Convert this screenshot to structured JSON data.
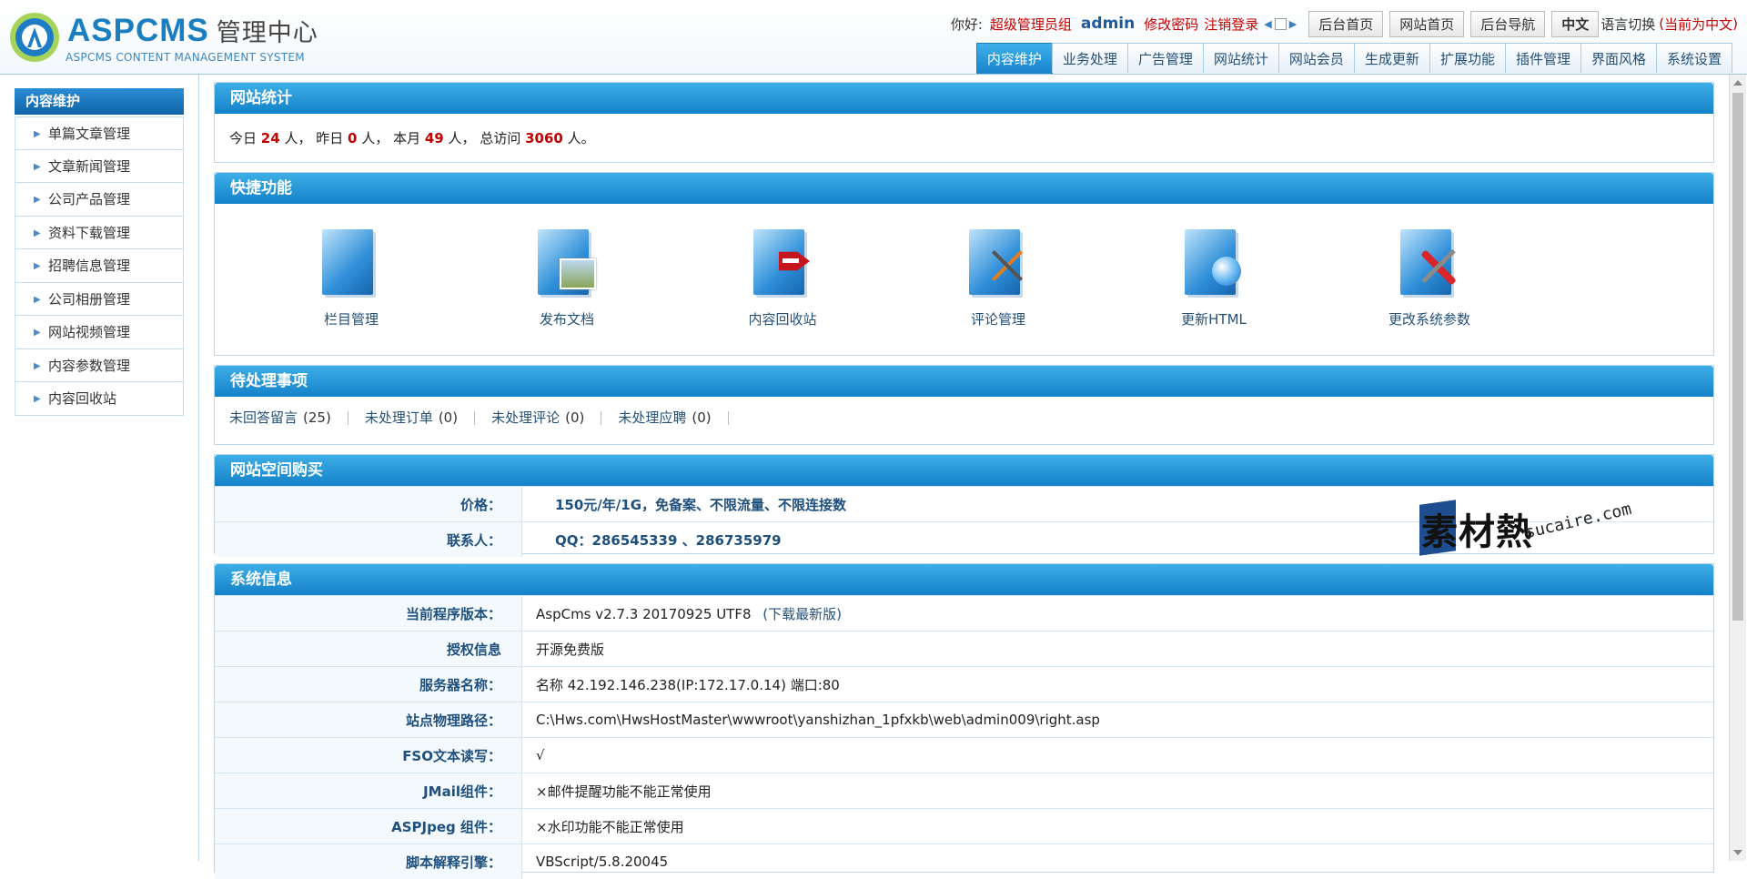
{
  "header": {
    "logo_text": "ASPCMS",
    "logo_subtitle_cn": "管理中心",
    "logo_tagline": "ASPCMS CONTENT MANAGEMENT SYSTEM",
    "greeting": "你好:",
    "role": "超级管理员组",
    "username": "admin",
    "change_password": "修改密码",
    "logout": "注销登录",
    "buttons": [
      "后台首页",
      "网站首页",
      "后台导航",
      "中文"
    ],
    "lang_switch": "语言切换",
    "lang_current_open": "(",
    "lang_current": "当前为中文",
    "lang_current_close": ")",
    "tabs": [
      "内容维护",
      "业务处理",
      "广告管理",
      "网站统计",
      "网站会员",
      "生成更新",
      "扩展功能",
      "插件管理",
      "界面风格",
      "系统设置"
    ],
    "active_tab": "内容维护"
  },
  "sidebar": {
    "title": "内容维护",
    "items": [
      "单篇文章管理",
      "文章新闻管理",
      "公司产品管理",
      "资料下载管理",
      "招聘信息管理",
      "公司相册管理",
      "网站视频管理",
      "内容参数管理",
      "内容回收站"
    ]
  },
  "stats_panel": {
    "title": "网站统计",
    "today_label": "今日",
    "today": "24",
    "unit1": "人，",
    "yesterday_label": "昨日",
    "yesterday": "0",
    "unit2": "人，",
    "month_label": "本月",
    "month": "49",
    "unit3": "人，",
    "total_label": "总访问",
    "total": "3060",
    "unit4": "人。"
  },
  "quick_panel": {
    "title": "快捷功能",
    "items": [
      {
        "label": "栏目管理",
        "icon": "folder-icon"
      },
      {
        "label": "发布文档",
        "icon": "folder-image-icon"
      },
      {
        "label": "内容回收站",
        "icon": "folder-delete-icon"
      },
      {
        "label": "评论管理",
        "icon": "folder-edit-icon"
      },
      {
        "label": "更新HTML",
        "icon": "folder-globe-icon"
      },
      {
        "label": "更改系统参数",
        "icon": "folder-tools-icon"
      }
    ]
  },
  "todo_panel": {
    "title": "待处理事项",
    "items": [
      {
        "label": "未回答留言",
        "count": "(25)"
      },
      {
        "label": "未处理订单",
        "count": "(0)"
      },
      {
        "label": "未处理评论",
        "count": "(0)"
      },
      {
        "label": "未处理应聘",
        "count": "(0)"
      }
    ]
  },
  "hosting_panel": {
    "title": "网站空间购买",
    "rows": [
      {
        "key": "价格：",
        "value": "150元/年/1G，免备案、不限流量、不限连接数"
      },
      {
        "key": "联系人：",
        "value": "QQ：286545339 、286735979"
      }
    ]
  },
  "sysinfo_panel": {
    "title": "系统信息",
    "rows": [
      {
        "key": "当前程序版本：",
        "value": "AspCms v2.7.3 20170925 UTF8",
        "link": "(下载最新版)"
      },
      {
        "key": "授权信息",
        "value": "开源免费版"
      },
      {
        "key": "服务器名称：",
        "value": "名称 42.192.146.238(IP:172.17.0.14) 端口:80"
      },
      {
        "key": "站点物理路径：",
        "value": "C:\\Hws.com\\HwsHostMaster\\wwwroot\\yanshizhan_1pfxkb\\web\\admin009\\right.asp"
      },
      {
        "key": "FSO文本读写：",
        "value": "√"
      },
      {
        "key": "JMail组件：",
        "value": "×邮件提醒功能不能正常使用"
      },
      {
        "key": "ASPJpeg 组件：",
        "value": "×水印功能不能正常使用"
      },
      {
        "key": "脚本解释引擎：",
        "value": "VBScript/5.8.20045"
      }
    ]
  },
  "watermark": {
    "cn": "素材熱",
    "en": "sucaire.com"
  }
}
